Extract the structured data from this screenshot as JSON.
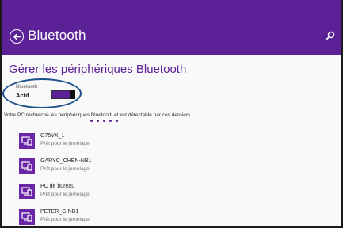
{
  "header": {
    "title": "Bluetooth",
    "color": "#5c2196"
  },
  "page": {
    "title": "Gérer les périphériques Bluetooth"
  },
  "bluetooth_toggle": {
    "label": "Bluetooth",
    "state": "Actif",
    "on": true
  },
  "description": "Votre PC recherche les périphériques Bluetooth et est détectable par ces derniers.",
  "devices": [
    {
      "name": "G75VX_1",
      "status": "Prêt pour le jumelage"
    },
    {
      "name": "GARYC_CHEN-NB1",
      "status": "Prêt pour le jumelage"
    },
    {
      "name": "PC de bureau",
      "status": "Prêt pour le jumelage"
    },
    {
      "name": "PETER_C-NB1",
      "status": "Prêt pour le jumelage"
    }
  ],
  "icons": {
    "back": "back-arrow-icon",
    "search": "search-icon",
    "device": "computer-device-icon"
  }
}
